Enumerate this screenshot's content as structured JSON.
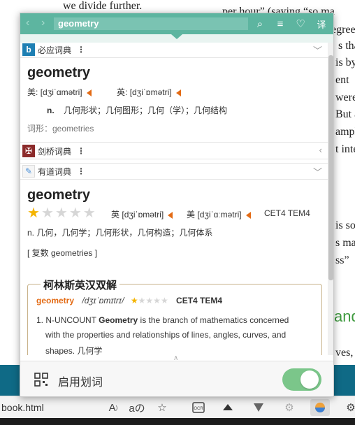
{
  "background": {
    "lines": [
      "we divide further.",
      "per hour” (saying “so ma",
      "egrees",
      "s tha",
      "is by",
      "ent",
      "were",
      "But a",
      "ample",
      "t inte",
      "is so",
      "s ma",
      "ss”",
      "and",
      "ves,"
    ]
  },
  "popup": {
    "search_value": "geometry",
    "nav_back": "‹",
    "nav_forward": "›",
    "icons": [
      "search-icon",
      "menu-icon",
      "heart-icon",
      "translate-icon"
    ],
    "icon_glyphs": {
      "search": "⌕",
      "menu": "≡",
      "heart": "♡",
      "translate": "译"
    }
  },
  "bing": {
    "title": "必应词典",
    "menu": "⋮",
    "word": "geometry",
    "us_label": "美:",
    "us_phonetic": "[dʒiˈɑmətri]",
    "uk_label": "英:",
    "uk_phonetic": "[dʒiˈɒmətri]",
    "pos": "n.",
    "definition": "几何形状；几何图形；几何（学）；几何结构",
    "forms": "词形：geometries"
  },
  "cambridge": {
    "title": "剑桥词典",
    "menu": "⋮"
  },
  "youdao": {
    "title": "有道词典",
    "menu": "⋮",
    "word": "geometry",
    "stars_filled": 1,
    "stars_total": 5,
    "uk_label": "英",
    "uk_phonetic": "[dʒiˈɒmətri]",
    "us_label": "美",
    "us_phonetic": "[dʒiˈɑːmətri]",
    "tags": "CET4 TEM4",
    "definition": "n. 几何，几何学；几何形状，几何构造；几何体系",
    "plural": "[ 复数 geometries ]"
  },
  "collins": {
    "title": "柯林斯英汉双解",
    "word": "geometry",
    "phonetic": "/dʒɪˈɒmɪtrɪ/",
    "stars_filled": 1,
    "stars_total": 5,
    "tags": "CET4 TEM4",
    "sense_number": "1.",
    "sense_type": "N-UNCOUNT",
    "sense_head": "Geometry",
    "sense_rest": " is the branch of mathematics concerned",
    "sense_line2": "with the properties and relationships of lines, angles, curves, and",
    "sense_line3": "shapes. 几何学"
  },
  "footer": {
    "label": "启用划词",
    "toggle_on": true
  },
  "browser": {
    "url_fragment": "book.html",
    "toolbar_icons": [
      "read-aloud-icon",
      "translate-icon",
      "add-favorite-icon",
      "ocr-icon",
      "extension-icon",
      "vee-icon",
      "settings-cog-icon",
      "dictionary-extension-icon",
      "more-icon"
    ]
  },
  "colors": {
    "accent_teal": "#5db5a0",
    "speaker_orange": "#e36b15",
    "star_gold": "#f4b400",
    "collins_word": "#e36b15",
    "toggle_green": "#7bc68a"
  }
}
